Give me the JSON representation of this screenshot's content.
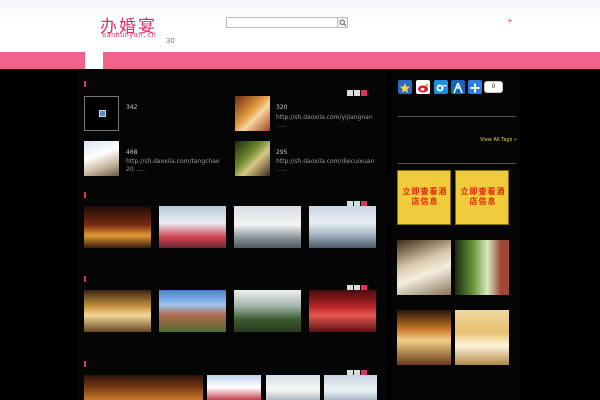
{
  "header": {
    "logo_cn": "办婚宴",
    "logo_en": "banhunyan.cn",
    "count": "30",
    "plus": "+"
  },
  "icons": {
    "search": "search-icon",
    "share": [
      "star-icon",
      "weibo-icon",
      "qq-icon",
      "renren-icon",
      "plus-share-icon"
    ]
  },
  "colors": {
    "brand": "#e0306a",
    "navbar": "#f2628c",
    "tag_link": "#e9d34a",
    "ad_bg": "#f0cb3c",
    "ad_text": "#e12a10"
  },
  "featured": [
    {
      "count": "342",
      "url": "",
      "more": ""
    },
    {
      "count": "320",
      "url": "http://sh.daoxila.com/yijiangnan",
      "more": "......"
    },
    {
      "count": "468",
      "url": "http://sh.daoxila.com/tangchao",
      "url2": "20......",
      "more": ""
    },
    {
      "count": "295",
      "url": "http://sh.daoxila.com/diecuixuan",
      "more": "......"
    }
  ],
  "sidebar": {
    "share_count": "0",
    "view_all_tags": "View All Tags »",
    "ad_text": "立即查看酒店信息"
  }
}
